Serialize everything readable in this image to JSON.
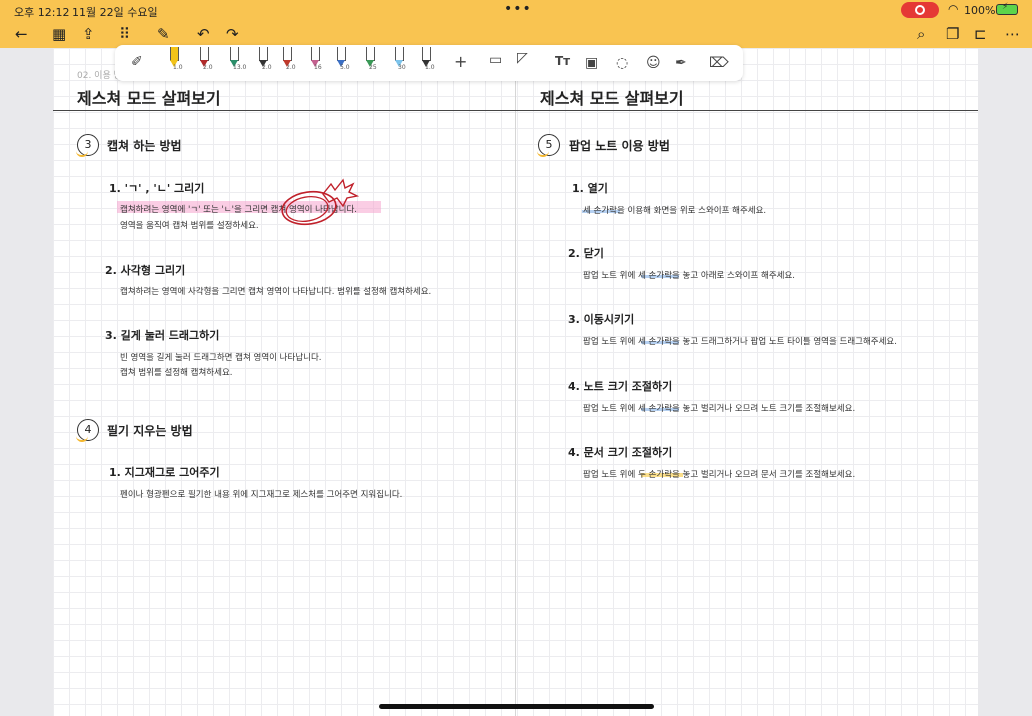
{
  "status": {
    "time": "오후 12:12",
    "date": "11월 22일 수요일",
    "battery": "100%"
  },
  "pentools": {
    "pen_sizes": [
      "1.0",
      "2.0",
      "13.0",
      "2.0",
      "2.0",
      "16",
      "5.0",
      "25",
      "30",
      "1.0"
    ],
    "pen_colors": [
      "#f2c318",
      "#b22a2a",
      "#2a8f6a",
      "#333333",
      "#c0392b",
      "#c4608f",
      "#3b6fc4",
      "#3a9a57",
      "#7cc4ec",
      "#333333"
    ],
    "plus": "+",
    "text_tool": "Tт"
  },
  "page": {
    "breadcrumb": "02. 이용 방",
    "left_title": "제스쳐 모드 살펴보기",
    "right_title": "제스쳐 모드 살펴보기"
  },
  "left": {
    "sec3": {
      "num": "3",
      "title": "캡쳐 하는 방법"
    },
    "item1": {
      "title": "1. 'ㄱ' , 'ㄴ' 그리기",
      "line1": "캡쳐하려는 영역에 'ㄱ' 또는 'ㄴ'을 그리면 캡쳐 영역이 나타납니다.",
      "line2": "영역을 움직여 캡쳐 범위를 설정하세요."
    },
    "item2": {
      "title": "2. 사각형 그리기",
      "line1": "캡쳐하려는 영역에 사각형을 그리면 캡쳐 영역이 나타납니다. 범위를 설정해 캡쳐하세요."
    },
    "item3": {
      "title": "3. 길게 눌러 드래그하기",
      "line1": "빈 영역을 길게 눌러 드래그하면 캡쳐 영역이 나타납니다.",
      "line2": "캡쳐 범위를 설정해 캡쳐하세요."
    },
    "sec4": {
      "num": "4",
      "title": "필기 지우는 방법"
    },
    "item4": {
      "title": "1. 지그재그로 그어주기",
      "line1": "펜이나 형광펜으로 필기한 내용 위에 지그재그로 제스처를 그어주면 지워집니다."
    }
  },
  "right": {
    "sec5": {
      "num": "5",
      "title": "팝업 노트 이용 방법"
    },
    "item1": {
      "title": "1. 열기",
      "line1": "세 손가락을 이용해 화면을 위로 스와이프 해주세요."
    },
    "item2": {
      "title": "2. 닫기",
      "line1": "팝업 노트 위에 세 손가락을 놓고 아래로 스와이프 해주세요."
    },
    "item3": {
      "title": "3. 이동시키기",
      "line1": "팝업 노트 위에 세 손가락을 놓고 드래그하거나 팝업 노트 타이틀 영역을 드래그해주세요."
    },
    "item4": {
      "title": "4. 노트 크기 조절하기",
      "line1": "팝업 노트 위에 세 손가락을 놓고 벌리거나 오므려 노트 크기를 조절해보세요."
    },
    "item5": {
      "title": "4. 문서 크기 조절하기",
      "line1": "팝업 노트 위에 두 손가락을 놓고 벌리거나 오므려 문서 크기를 조절해보세요."
    }
  }
}
